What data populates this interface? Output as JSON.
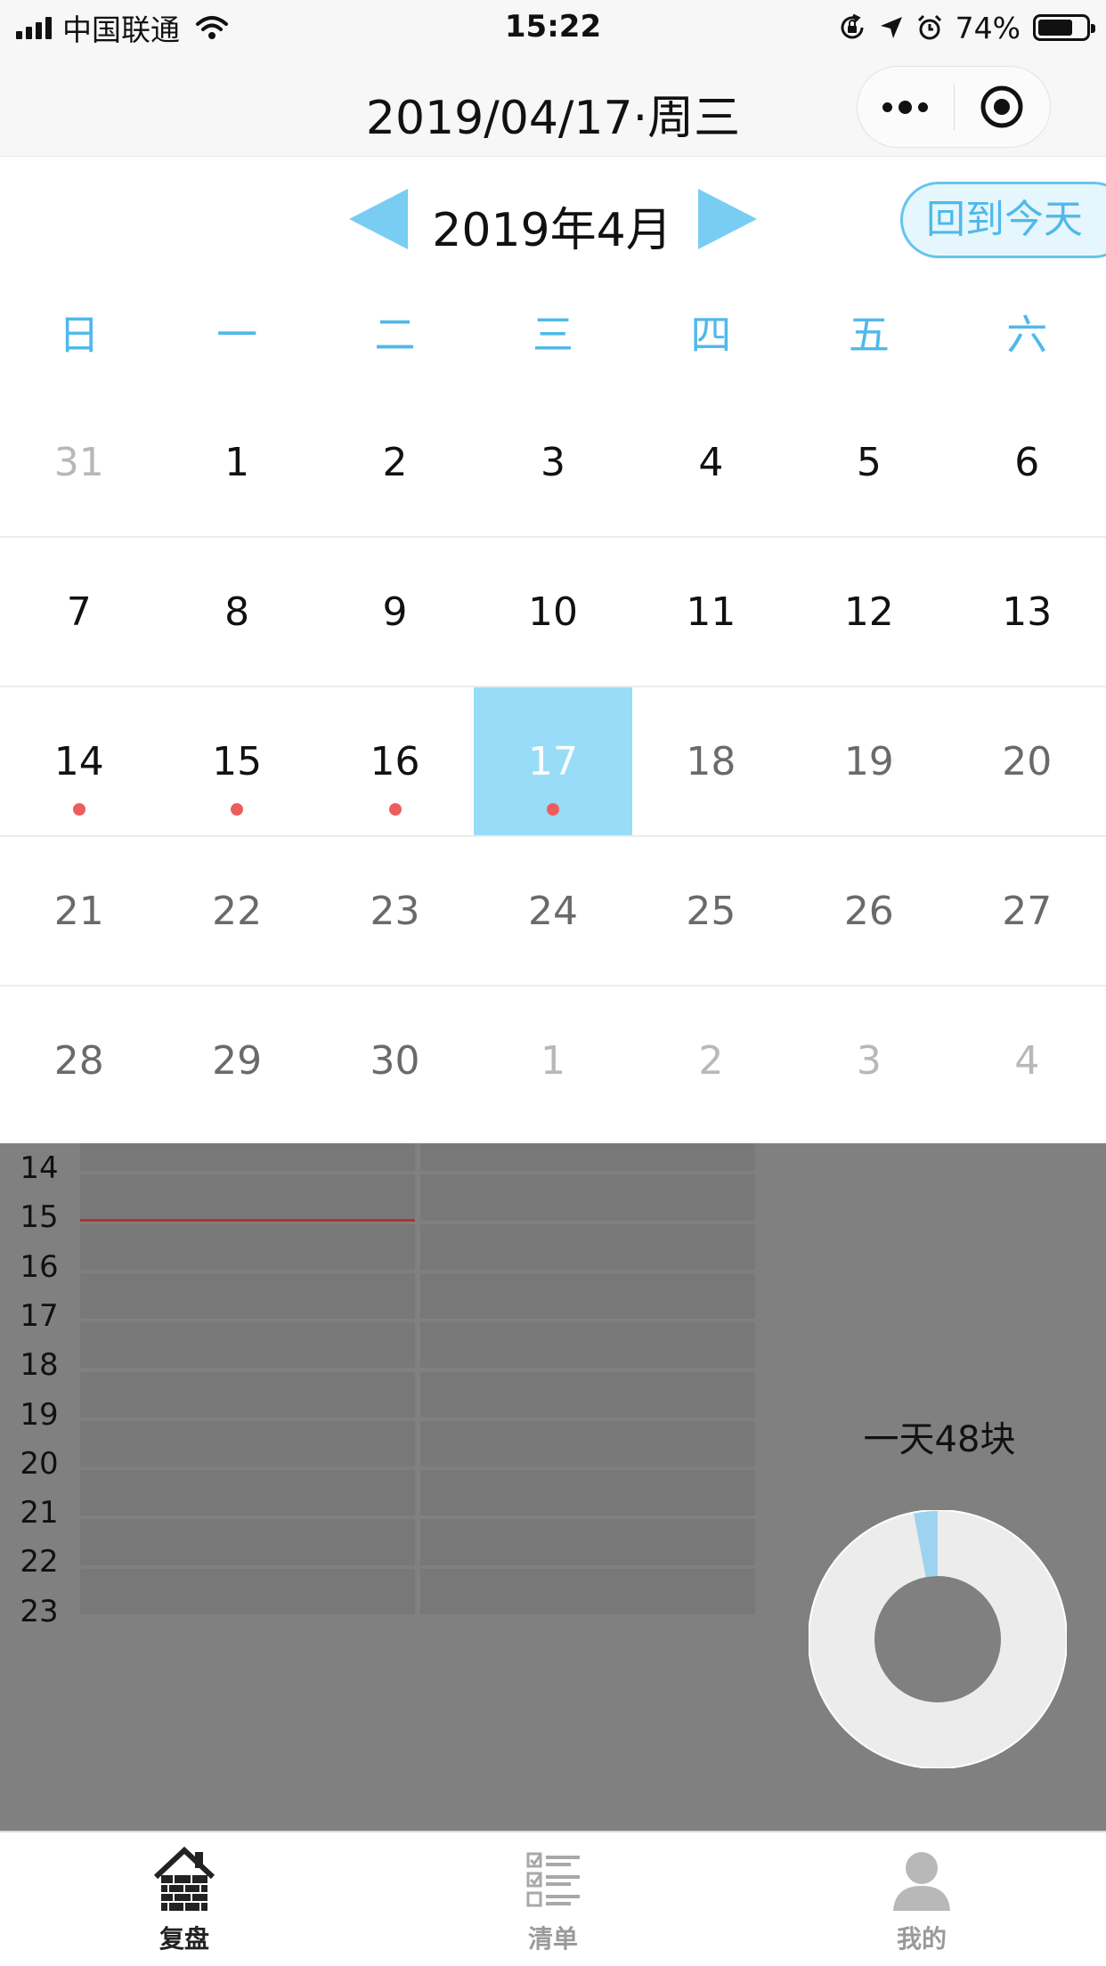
{
  "status_bar": {
    "carrier": "中国联通",
    "time": "15:22",
    "battery_pct": "74%",
    "battery_level": 0.74
  },
  "nav": {
    "title": "2019/04/17·周三"
  },
  "calendar": {
    "month_label": "2019年4月",
    "today_button": "回到今天",
    "weekdays": [
      "日",
      "一",
      "二",
      "三",
      "四",
      "五",
      "六"
    ],
    "weeks": [
      [
        "31",
        "1",
        "2",
        "3",
        "4",
        "5",
        "6"
      ],
      [
        "7",
        "8",
        "9",
        "10",
        "11",
        "12",
        "13"
      ],
      [
        "14",
        "15",
        "16",
        "17",
        "18",
        "19",
        "20"
      ],
      [
        "21",
        "22",
        "23",
        "24",
        "25",
        "26",
        "27"
      ],
      [
        "28",
        "29",
        "30",
        "1",
        "2",
        "3",
        "4"
      ]
    ],
    "selected_date": "17",
    "dot_dates": [
      "14",
      "15",
      "16",
      "17"
    ],
    "accent_color": "#4fb9ea",
    "selected_color": "#99dcf7",
    "dot_color": "#ee5d5d"
  },
  "schedule": {
    "hours": [
      "14",
      "15",
      "16",
      "17",
      "18",
      "19",
      "20",
      "21",
      "22",
      "23"
    ],
    "quota_text": "一天48块",
    "used_fraction": 0.03
  },
  "tabs": [
    {
      "label": "复盘",
      "icon": "house-bricks-icon",
      "active": true
    },
    {
      "label": "清单",
      "icon": "checklist-icon",
      "active": false
    },
    {
      "label": "我的",
      "icon": "user-icon",
      "active": false
    }
  ]
}
